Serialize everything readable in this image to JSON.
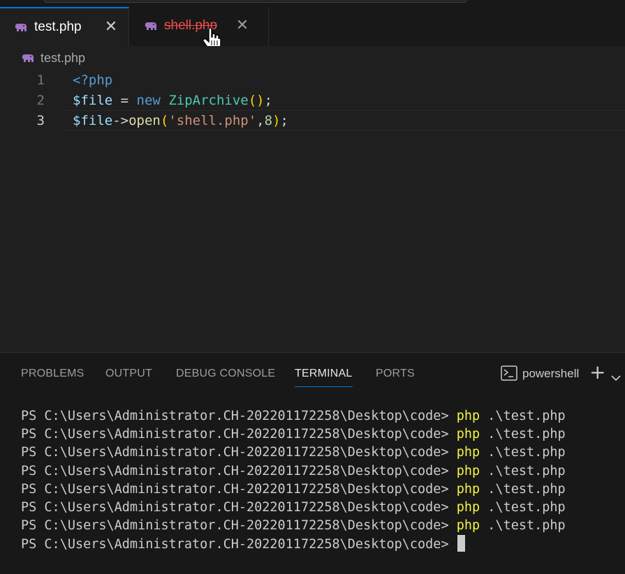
{
  "tabs": [
    {
      "label": "test.php",
      "close": "✕",
      "active": true
    },
    {
      "label": "shell.php",
      "close": "✕",
      "active": false,
      "deleted": true
    }
  ],
  "breadcrumb": {
    "file": "test.php"
  },
  "editor": {
    "lines": [
      {
        "number": "1",
        "tokens": [
          {
            "t": "<?php",
            "c": "c-tag"
          }
        ]
      },
      {
        "number": "2",
        "tokens": [
          {
            "t": "$file",
            "c": "c-var"
          },
          {
            "t": " = ",
            "c": "c-op"
          },
          {
            "t": "new",
            "c": "c-kw"
          },
          {
            "t": " ",
            "c": "c-op"
          },
          {
            "t": "ZipArchive",
            "c": "c-cls"
          },
          {
            "t": "()",
            "c": "c-par"
          },
          {
            "t": ";",
            "c": "c-op"
          }
        ]
      },
      {
        "number": "3",
        "current": true,
        "tokens": [
          {
            "t": "$file",
            "c": "c-var"
          },
          {
            "t": "->",
            "c": "c-op"
          },
          {
            "t": "open",
            "c": "c-fn"
          },
          {
            "t": "(",
            "c": "c-par"
          },
          {
            "t": "'shell.php'",
            "c": "c-str"
          },
          {
            "t": ",",
            "c": "c-op"
          },
          {
            "t": "8",
            "c": "c-num"
          },
          {
            "t": ")",
            "c": "c-par"
          },
          {
            "t": ";",
            "c": "c-op"
          }
        ]
      }
    ]
  },
  "panel": {
    "tabs": [
      {
        "label": "PROBLEMS",
        "active": false
      },
      {
        "label": "OUTPUT",
        "active": false
      },
      {
        "label": "DEBUG CONSOLE",
        "active": false
      },
      {
        "label": "TERMINAL",
        "active": true
      },
      {
        "label": "PORTS",
        "active": false
      }
    ],
    "shell": "powershell",
    "add": "+"
  },
  "terminal": {
    "lines": [
      {
        "prompt": "PS C:\\Users\\Administrator.CH-202201172258\\Desktop\\code>",
        "cmd": "php",
        "arg": ".\\test.php"
      },
      {
        "prompt": "PS C:\\Users\\Administrator.CH-202201172258\\Desktop\\code>",
        "cmd": "php",
        "arg": ".\\test.php"
      },
      {
        "prompt": "PS C:\\Users\\Administrator.CH-202201172258\\Desktop\\code>",
        "cmd": "php",
        "arg": ".\\test.php"
      },
      {
        "prompt": "PS C:\\Users\\Administrator.CH-202201172258\\Desktop\\code>",
        "cmd": "php",
        "arg": ".\\test.php"
      },
      {
        "prompt": "PS C:\\Users\\Administrator.CH-202201172258\\Desktop\\code>",
        "cmd": "php",
        "arg": ".\\test.php"
      },
      {
        "prompt": "PS C:\\Users\\Administrator.CH-202201172258\\Desktop\\code>",
        "cmd": "php",
        "arg": ".\\test.php"
      },
      {
        "prompt": "PS C:\\Users\\Administrator.CH-202201172258\\Desktop\\code>",
        "cmd": "php",
        "arg": ".\\test.php"
      }
    ],
    "last_prompt": "PS C:\\Users\\Administrator.CH-202201172258\\Desktop\\code>"
  },
  "colors": {
    "accent": "#0078d4",
    "deleted_file": "#f14c4c",
    "php_icon": "#a074c4",
    "terminal_command": "#f5f543"
  },
  "icons": {
    "tab_file": "php-elephant-icon",
    "close": "close-icon",
    "terminal": "terminal-icon",
    "add": "plus-icon",
    "dropdown": "chevron-down-icon",
    "cursor": "hand-pointer-icon"
  }
}
